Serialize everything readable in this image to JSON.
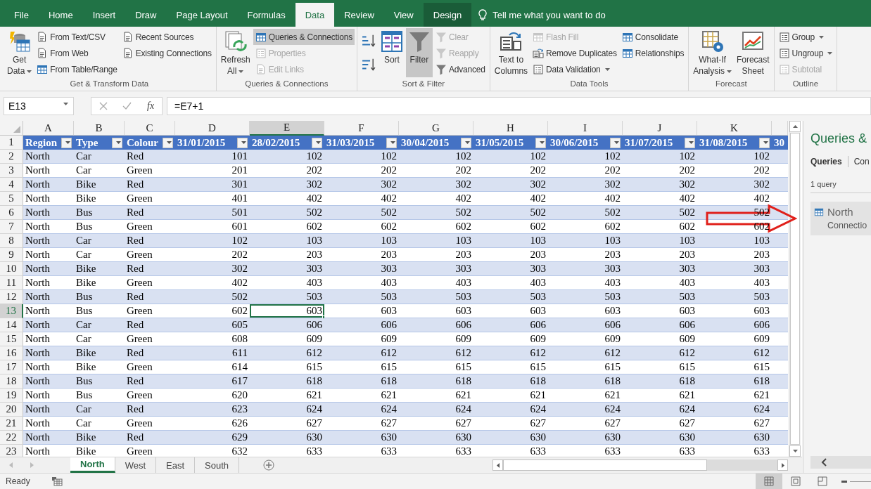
{
  "tabs": [
    {
      "label": "File",
      "selected": false,
      "kind": "standard"
    },
    {
      "label": "Home",
      "selected": false,
      "kind": "standard"
    },
    {
      "label": "Insert",
      "selected": false,
      "kind": "standard"
    },
    {
      "label": "Draw",
      "selected": false,
      "kind": "standard"
    },
    {
      "label": "Page Layout",
      "selected": false,
      "kind": "standard"
    },
    {
      "label": "Formulas",
      "selected": false,
      "kind": "standard"
    },
    {
      "label": "Data",
      "selected": true,
      "kind": "standard"
    },
    {
      "label": "Review",
      "selected": false,
      "kind": "standard"
    },
    {
      "label": "View",
      "selected": false,
      "kind": "standard"
    },
    {
      "label": "Design",
      "selected": false,
      "kind": "contextual"
    }
  ],
  "tell_me": {
    "placeholder": "Tell me what you want to do"
  },
  "ribbon": {
    "groups": [
      {
        "label": "Get & Transform Data",
        "columns": [
          {
            "kind": "large",
            "label": "Get\nData",
            "dropdown": true,
            "selected": false,
            "disabled": false
          },
          {
            "kind": "stack",
            "items": [
              {
                "label": "From Text/CSV",
                "dropdown": false,
                "selected": false,
                "disabled": false
              },
              {
                "label": "From Web",
                "dropdown": false,
                "selected": false,
                "disabled": false
              },
              {
                "label": "From Table/Range",
                "dropdown": false,
                "selected": false,
                "disabled": false
              }
            ]
          },
          {
            "kind": "stack",
            "items": [
              {
                "label": "Recent Sources",
                "dropdown": false,
                "selected": false,
                "disabled": false
              },
              {
                "label": "Existing Connections",
                "dropdown": false,
                "selected": false,
                "disabled": false
              }
            ]
          }
        ]
      },
      {
        "label": "Queries & Connections",
        "columns": [
          {
            "kind": "large",
            "label": "Refresh\nAll",
            "dropdown": true,
            "selected": false,
            "disabled": false
          },
          {
            "kind": "stack",
            "items": [
              {
                "label": "Queries & Connections",
                "dropdown": false,
                "selected": true,
                "disabled": false
              },
              {
                "label": "Properties",
                "dropdown": false,
                "selected": false,
                "disabled": true
              },
              {
                "label": "Edit Links",
                "dropdown": false,
                "selected": false,
                "disabled": true
              }
            ]
          }
        ]
      },
      {
        "label": "Sort & Filter",
        "columns": [
          {
            "kind": "sort-icons"
          },
          {
            "kind": "large",
            "label": "Sort",
            "dropdown": false,
            "selected": false,
            "disabled": false
          },
          {
            "kind": "large",
            "label": "Filter",
            "dropdown": false,
            "selected": true,
            "disabled": false
          },
          {
            "kind": "stack",
            "items": [
              {
                "label": "Clear",
                "dropdown": false,
                "selected": false,
                "disabled": true
              },
              {
                "label": "Reapply",
                "dropdown": false,
                "selected": false,
                "disabled": true
              },
              {
                "label": "Advanced",
                "dropdown": false,
                "selected": false,
                "disabled": false
              }
            ]
          }
        ]
      },
      {
        "label": "Data Tools",
        "columns": [
          {
            "kind": "large",
            "label": "Text to\nColumns",
            "dropdown": false,
            "selected": false,
            "disabled": false
          },
          {
            "kind": "stack",
            "items": [
              {
                "label": "Flash Fill",
                "dropdown": false,
                "selected": false,
                "disabled": true
              },
              {
                "label": "Remove Duplicates",
                "dropdown": false,
                "selected": false,
                "disabled": false
              },
              {
                "label": "Data Validation",
                "dropdown": true,
                "selected": false,
                "disabled": false
              }
            ]
          },
          {
            "kind": "stack",
            "items": [
              {
                "label": "Consolidate",
                "dropdown": false,
                "selected": false,
                "disabled": false
              },
              {
                "label": "Relationships",
                "dropdown": false,
                "selected": false,
                "disabled": false
              }
            ]
          }
        ]
      },
      {
        "label": "Forecast",
        "columns": [
          {
            "kind": "large",
            "label": "What-If\nAnalysis",
            "dropdown": true,
            "selected": false,
            "disabled": false
          },
          {
            "kind": "large",
            "label": "Forecast\nSheet",
            "dropdown": false,
            "selected": false,
            "disabled": false
          }
        ]
      },
      {
        "label": "Outline",
        "columns": [
          {
            "kind": "stack",
            "items": [
              {
                "label": "Group",
                "dropdown": true,
                "selected": false,
                "disabled": false
              },
              {
                "label": "Ungroup",
                "dropdown": true,
                "selected": false,
                "disabled": false
              },
              {
                "label": "Subtotal",
                "dropdown": false,
                "selected": false,
                "disabled": true
              }
            ]
          }
        ]
      }
    ]
  },
  "formula_bar": {
    "name_box": {
      "value": "E13"
    },
    "function_label": "fx",
    "formula": {
      "value": "=E7+1"
    }
  },
  "sheet": {
    "columns": [
      {
        "letter": "A",
        "selected": false
      },
      {
        "letter": "B",
        "selected": false
      },
      {
        "letter": "C",
        "selected": false
      },
      {
        "letter": "D",
        "selected": false
      },
      {
        "letter": "E",
        "selected": true
      },
      {
        "letter": "F",
        "selected": false
      },
      {
        "letter": "G",
        "selected": false
      },
      {
        "letter": "H",
        "selected": false
      },
      {
        "letter": "I",
        "selected": false
      },
      {
        "letter": "J",
        "selected": false
      },
      {
        "letter": "K",
        "selected": false
      },
      {
        "selected": false
      }
    ],
    "header_row": {
      "number": "1",
      "selected": false,
      "cells": [
        "Region",
        "Type",
        "Colour",
        "31/01/2015",
        "28/02/2015",
        "31/03/2015",
        "30/04/2015",
        "31/05/2015",
        "30/06/2015",
        "31/07/2015",
        "31/08/2015",
        "30"
      ]
    },
    "rows": [
      {
        "number": "2",
        "selected": false,
        "cells": [
          "North",
          "Car",
          "Red",
          "101",
          "102",
          "102",
          "102",
          "102",
          "102",
          "102",
          "102"
        ]
      },
      {
        "number": "3",
        "selected": false,
        "cells": [
          "North",
          "Car",
          "Green",
          "201",
          "202",
          "202",
          "202",
          "202",
          "202",
          "202",
          "202"
        ]
      },
      {
        "number": "4",
        "selected": false,
        "cells": [
          "North",
          "Bike",
          "Red",
          "301",
          "302",
          "302",
          "302",
          "302",
          "302",
          "302",
          "302"
        ]
      },
      {
        "number": "5",
        "selected": false,
        "cells": [
          "North",
          "Bike",
          "Green",
          "401",
          "402",
          "402",
          "402",
          "402",
          "402",
          "402",
          "402"
        ]
      },
      {
        "number": "6",
        "selected": false,
        "cells": [
          "North",
          "Bus",
          "Red",
          "501",
          "502",
          "502",
          "502",
          "502",
          "502",
          "502",
          "502"
        ]
      },
      {
        "number": "7",
        "selected": false,
        "cells": [
          "North",
          "Bus",
          "Green",
          "601",
          "602",
          "602",
          "602",
          "602",
          "602",
          "602",
          "602"
        ]
      },
      {
        "number": "8",
        "selected": false,
        "cells": [
          "North",
          "Car",
          "Red",
          "102",
          "103",
          "103",
          "103",
          "103",
          "103",
          "103",
          "103"
        ]
      },
      {
        "number": "9",
        "selected": false,
        "cells": [
          "North",
          "Car",
          "Green",
          "202",
          "203",
          "203",
          "203",
          "203",
          "203",
          "203",
          "203"
        ]
      },
      {
        "number": "10",
        "selected": false,
        "cells": [
          "North",
          "Bike",
          "Red",
          "302",
          "303",
          "303",
          "303",
          "303",
          "303",
          "303",
          "303"
        ]
      },
      {
        "number": "11",
        "selected": false,
        "cells": [
          "North",
          "Bike",
          "Green",
          "402",
          "403",
          "403",
          "403",
          "403",
          "403",
          "403",
          "403"
        ]
      },
      {
        "number": "12",
        "selected": false,
        "cells": [
          "North",
          "Bus",
          "Red",
          "502",
          "503",
          "503",
          "503",
          "503",
          "503",
          "503",
          "503"
        ]
      },
      {
        "number": "13",
        "selected": true,
        "cells": [
          "North",
          "Bus",
          "Green",
          "602",
          "603",
          "603",
          "603",
          "603",
          "603",
          "603",
          "603"
        ]
      },
      {
        "number": "14",
        "selected": false,
        "cells": [
          "North",
          "Car",
          "Red",
          "605",
          "606",
          "606",
          "606",
          "606",
          "606",
          "606",
          "606"
        ]
      },
      {
        "number": "15",
        "selected": false,
        "cells": [
          "North",
          "Car",
          "Green",
          "608",
          "609",
          "609",
          "609",
          "609",
          "609",
          "609",
          "609"
        ]
      },
      {
        "number": "16",
        "selected": false,
        "cells": [
          "North",
          "Bike",
          "Red",
          "611",
          "612",
          "612",
          "612",
          "612",
          "612",
          "612",
          "612"
        ]
      },
      {
        "number": "17",
        "selected": false,
        "cells": [
          "North",
          "Bike",
          "Green",
          "614",
          "615",
          "615",
          "615",
          "615",
          "615",
          "615",
          "615"
        ]
      },
      {
        "number": "18",
        "selected": false,
        "cells": [
          "North",
          "Bus",
          "Red",
          "617",
          "618",
          "618",
          "618",
          "618",
          "618",
          "618",
          "618"
        ]
      },
      {
        "number": "19",
        "selected": false,
        "cells": [
          "North",
          "Bus",
          "Green",
          "620",
          "621",
          "621",
          "621",
          "621",
          "621",
          "621",
          "621"
        ]
      },
      {
        "number": "20",
        "selected": false,
        "cells": [
          "North",
          "Car",
          "Red",
          "623",
          "624",
          "624",
          "624",
          "624",
          "624",
          "624",
          "624"
        ]
      },
      {
        "number": "21",
        "selected": false,
        "cells": [
          "North",
          "Car",
          "Green",
          "626",
          "627",
          "627",
          "627",
          "627",
          "627",
          "627",
          "627"
        ]
      },
      {
        "number": "22",
        "selected": false,
        "cells": [
          "North",
          "Bike",
          "Red",
          "629",
          "630",
          "630",
          "630",
          "630",
          "630",
          "630",
          "630"
        ]
      },
      {
        "number": "23",
        "selected": false,
        "cells": [
          "North",
          "Bike",
          "Green",
          "632",
          "633",
          "633",
          "633",
          "633",
          "633",
          "633",
          "633"
        ]
      }
    ]
  },
  "sheet_tabs": [
    {
      "label": "North",
      "selected": true
    },
    {
      "label": "West",
      "selected": false
    },
    {
      "label": "East",
      "selected": false
    },
    {
      "label": "South",
      "selected": false
    }
  ],
  "queries_pane": {
    "title": "Queries &",
    "tabs": [
      {
        "label": "Queries",
        "selected": true
      },
      {
        "label": "Con",
        "selected": false
      }
    ],
    "count": "1 query",
    "items": [
      {
        "name": "North",
        "detail": "Connectio"
      }
    ]
  },
  "status_bar": {
    "text": "Ready",
    "views": [
      {
        "selected": true
      },
      {
        "selected": false
      },
      {
        "selected": false
      }
    ]
  }
}
